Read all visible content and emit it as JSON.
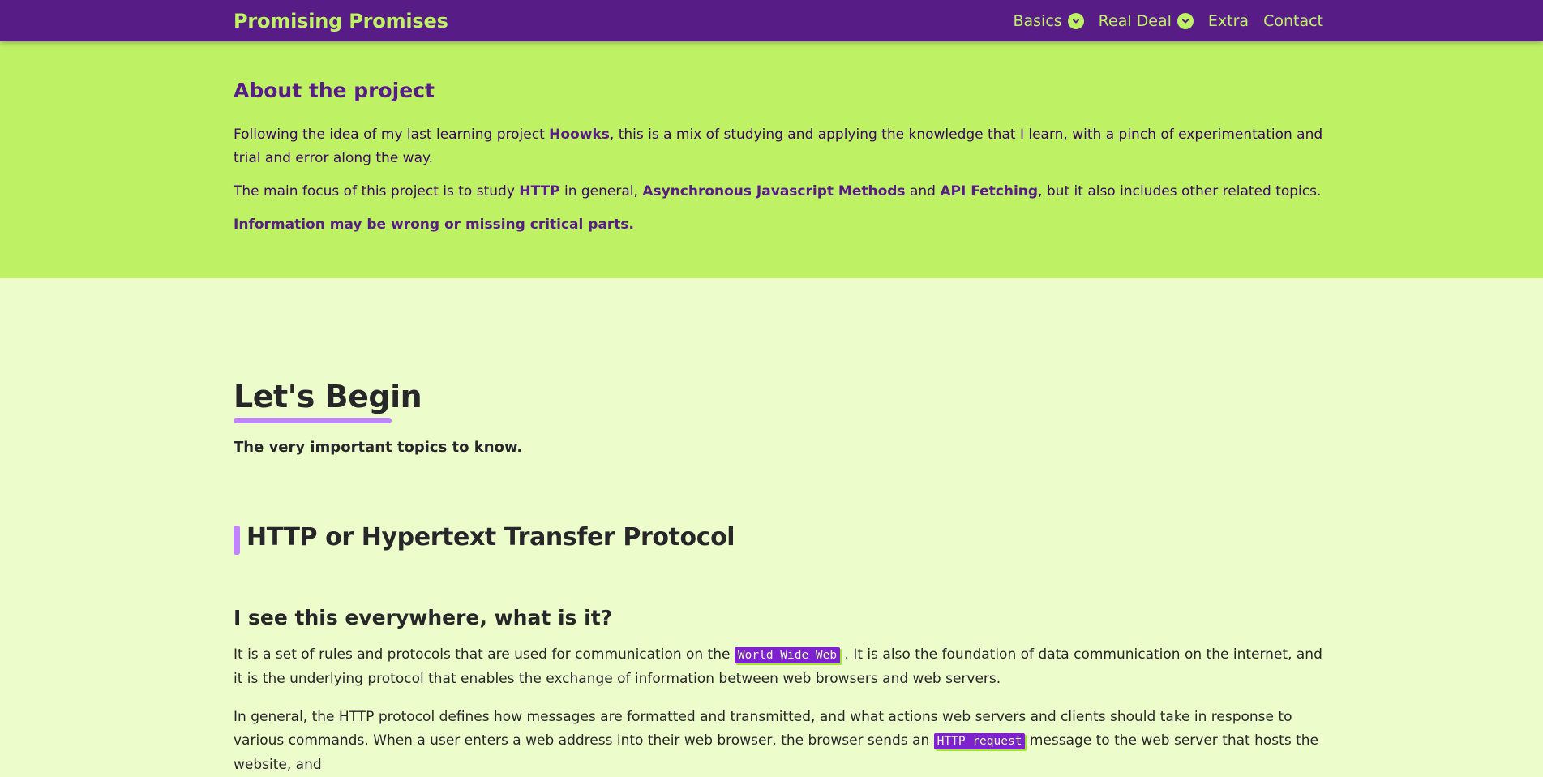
{
  "header": {
    "brand": "Promising Promises",
    "nav": [
      {
        "label": "Basics",
        "dropdown": true
      },
      {
        "label": "Real Deal",
        "dropdown": true
      },
      {
        "label": "Extra",
        "dropdown": false
      },
      {
        "label": "Contact",
        "dropdown": false
      }
    ]
  },
  "about": {
    "title": "About the project",
    "p1_pre": "Following the idea of my last learning project ",
    "p1_bold": "Hoowks",
    "p1_post": ", this is a mix of studying and applying the knowledge that I learn, with a pinch of experimentation and trial and error along the way.",
    "p2_pre": "The main focus of this project is to study ",
    "p2_b1": "HTTP",
    "p2_mid1": " in general, ",
    "p2_b2": "Asynchronous Javascript Methods",
    "p2_mid2": " and ",
    "p2_b3": "API Fetching",
    "p2_post": ", but it also includes other related topics.",
    "warning": "Information may be wrong or missing critical parts."
  },
  "main": {
    "title": "Let's Begin",
    "subtitle": "The very important topics to know.",
    "section_title": "HTTP or Hypertext Transfer Protocol",
    "question": "I see this everywhere, what is it?",
    "p1_pre": "It is a set of rules and protocols that are used for communication on the ",
    "p1_code": "World Wide Web",
    "p1_post": " . It is also the foundation of data communication on the internet, and it is the underlying protocol that enables the exchange of information between web browsers and web servers.",
    "p2_pre": "In general, the HTTP protocol defines how messages are formatted and transmitted, and what actions web servers and clients should take in response to various commands. When a user enters a web address into their web browser, the browser sends an ",
    "p2_code": "HTTP request",
    "p2_post": " message to the web server that hosts the website, and"
  },
  "colors": {
    "header_bg": "#581c87",
    "accent_lime": "#bef264",
    "page_bg": "#ecfccb",
    "accent_purple": "#c084fc"
  }
}
